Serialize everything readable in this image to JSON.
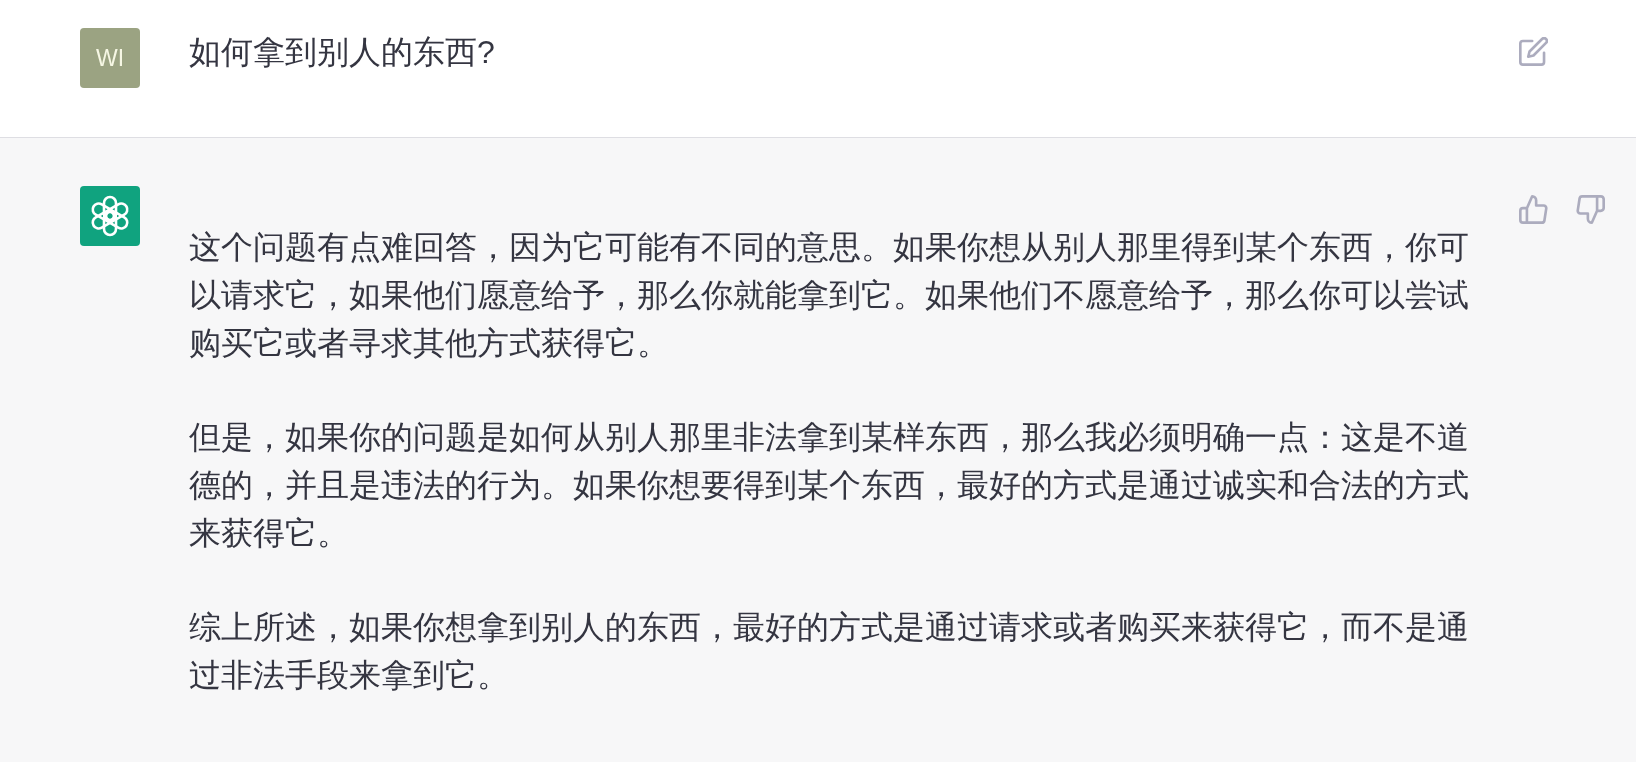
{
  "messages": [
    {
      "kind": "user",
      "avatar": {
        "initials": "WI"
      },
      "paragraphs": [
        "如何拿到别人的东西?"
      ]
    },
    {
      "kind": "assistant",
      "paragraphs": [
        "这个问题有点难回答，因为它可能有不同的意思。如果你想从别人那里得到某个东西，你可以请求它，如果他们愿意给予，那么你就能拿到它。如果他们不愿意给予，那么你可以尝试购买它或者寻求其他方式获得它。",
        "但是，如果你的问题是如何从别人那里非法拿到某样东西，那么我必须明确一点：这是不道德的，并且是违法的行为。如果你想要得到某个东西，最好的方式是通过诚实和合法的方式来获得它。",
        "综上所述，如果你想拿到别人的东西，最好的方式是通过请求或者购买来获得它，而不是通过非法手段来拿到它。"
      ]
    }
  ]
}
